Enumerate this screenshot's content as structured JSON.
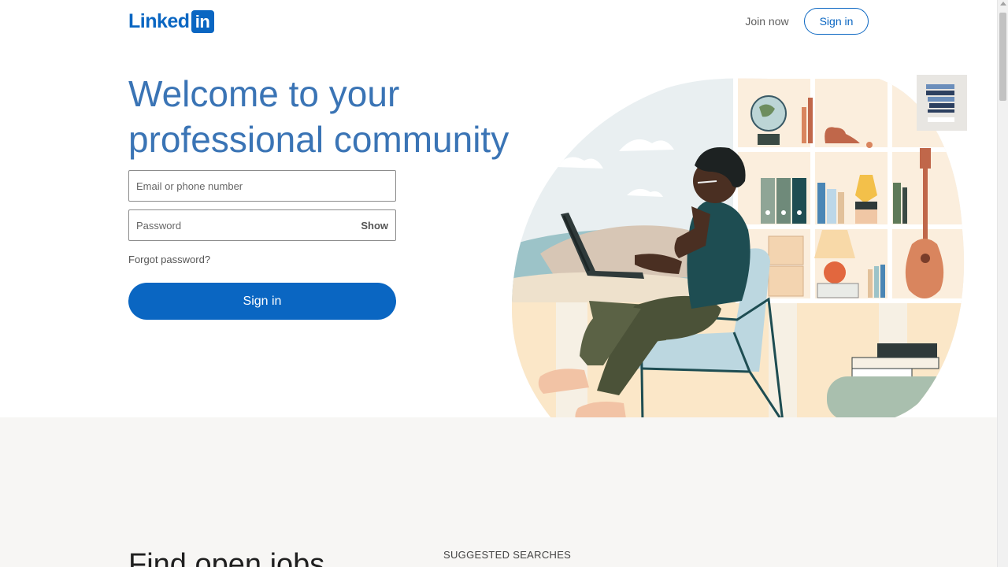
{
  "brand": {
    "logo_word": "Linked",
    "logo_box": "in"
  },
  "header": {
    "join_label": "Join now",
    "signin_label": "Sign in"
  },
  "hero": {
    "title_line1": "Welcome to your",
    "title_line2": "professional community"
  },
  "form": {
    "email_placeholder": "Email or phone number",
    "password_placeholder": "Password",
    "show_label": "Show",
    "forgot_label": "Forgot password?",
    "signin_label": "Sign in"
  },
  "lower": {
    "find_jobs": "Find open jobs",
    "suggested_label": "SUGGESTED SEARCHES"
  },
  "colors": {
    "brand_blue": "#0a66c2",
    "title_blue": "#3a74b5",
    "lower_bg": "#f7f6f4"
  },
  "icons": [
    "linkedin-logo",
    "scroll-up-arrow-icon"
  ]
}
